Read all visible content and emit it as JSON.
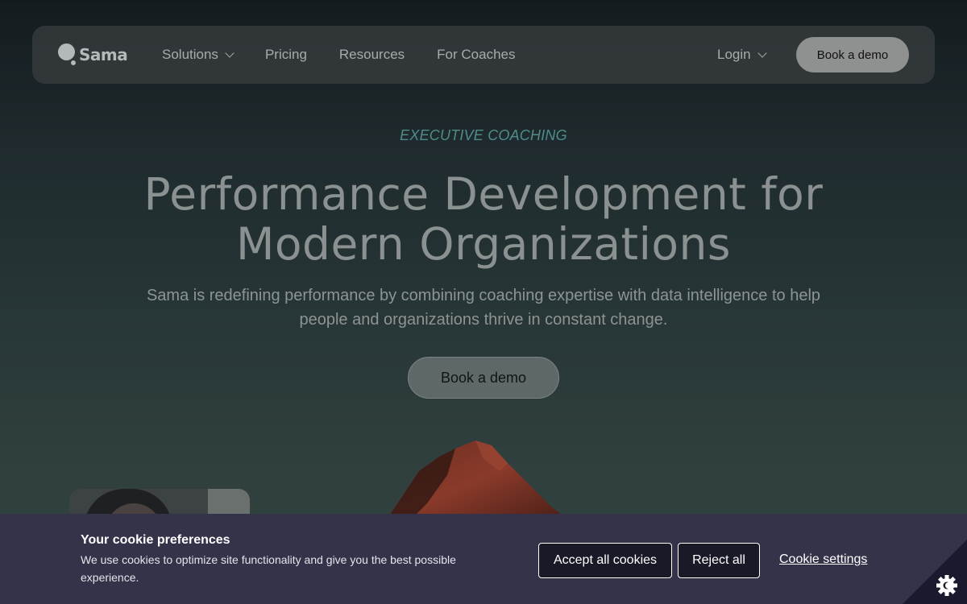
{
  "nav": {
    "logo_text": "Sama",
    "links": [
      {
        "label": "Solutions",
        "has_dropdown": true
      },
      {
        "label": "Pricing",
        "has_dropdown": false
      },
      {
        "label": "Resources",
        "has_dropdown": false
      },
      {
        "label": "For Coaches",
        "has_dropdown": false
      }
    ],
    "login_label": "Login",
    "cta_label": "Book a demo"
  },
  "hero": {
    "eyebrow": "EXECUTIVE COACHING",
    "headline_line1": "Performance Development for",
    "headline_line2": "Modern Organizations",
    "subhead_line1": "Sama is redefining performance by combining coaching expertise with data intelligence to help",
    "subhead_line2": "people and organizations thrive in constant change.",
    "cta_label": "Book a demo"
  },
  "cookie": {
    "title": "Your cookie preferences",
    "text": "We use cookies to optimize site functionality and give you the best possible experience.",
    "accept_label": "Accept all cookies",
    "reject_label": "Reject all",
    "settings_label": "Cookie settings"
  },
  "colors": {
    "accent_teal": "#4f8c8a",
    "cookie_bg": "#35334a",
    "corner_badge": "#1a1a2e"
  },
  "icons": {
    "logo": "speech-bubble-logo-icon",
    "dropdown": "chevron-down-icon",
    "cookie_settings": "cookie-gear-icon"
  }
}
